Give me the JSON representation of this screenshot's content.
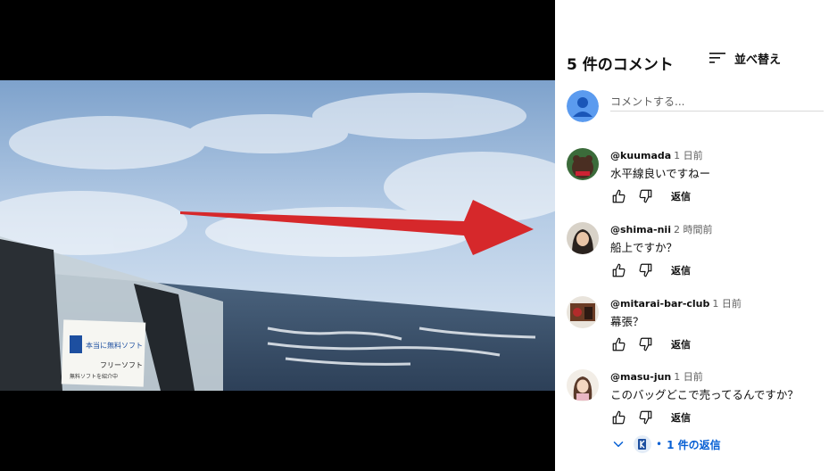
{
  "comments_header": {
    "title": "5 件のコメント",
    "sort_label": "並べ替え"
  },
  "composer": {
    "placeholder": "コメントする..."
  },
  "comments": [
    {
      "author": "@kuumada",
      "time": "1 日前",
      "text": "水平線良いですねー",
      "reply_label": "返信"
    },
    {
      "author": "@shima-nii",
      "time": "2 時間前",
      "text": "船上ですか？",
      "reply_label": "返信"
    },
    {
      "author": "@mitarai-bar-club",
      "time": "1 日前",
      "text": "幕張？",
      "reply_label": "返信"
    },
    {
      "author": "@masu-jun",
      "time": "1 日前",
      "text": "このバッグどこで売ってるんですか？",
      "reply_label": "返信"
    }
  ],
  "replies_toggle": {
    "label": "1 件の返信"
  },
  "video": {
    "bag_label_line1": "本当に無料ソフト",
    "bag_label_line2": "フリーソフト",
    "bag_label_line3": "無料ソフトを紹介中"
  },
  "colors": {
    "link": "#065fd4",
    "arrow": "#d6282b",
    "placeholder_avatar": "#4285f4"
  }
}
